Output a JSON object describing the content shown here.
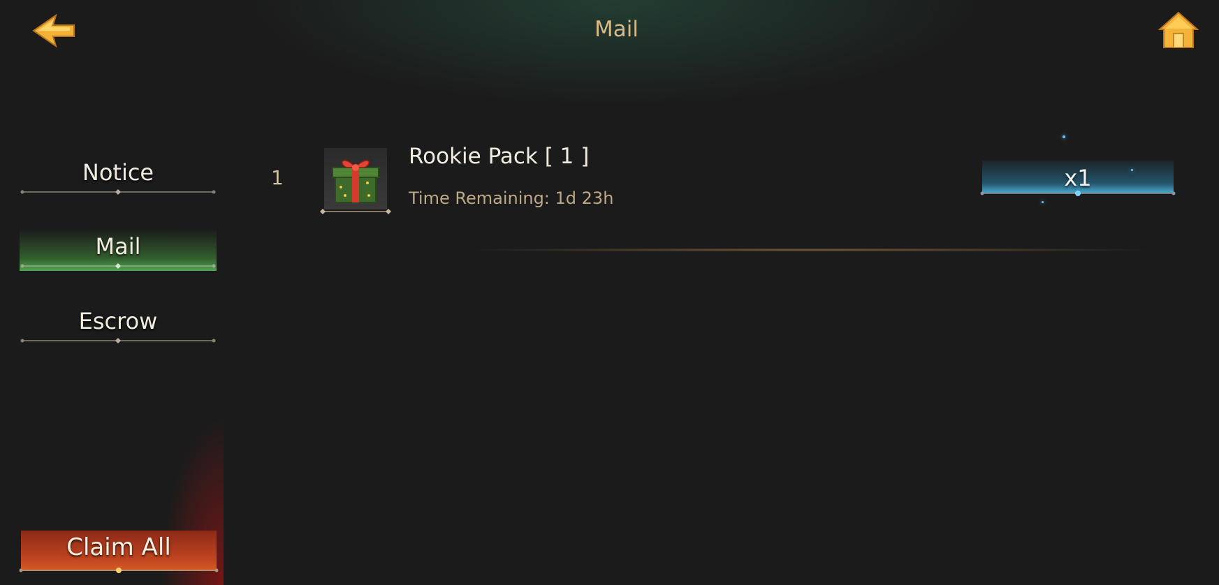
{
  "header": {
    "title": "Mail",
    "back_icon": "back-arrow-icon",
    "home_icon": "home-icon"
  },
  "sidebar": {
    "items": [
      {
        "label": "Notice",
        "active": false
      },
      {
        "label": "Mail",
        "active": true
      },
      {
        "label": "Escrow",
        "active": false
      }
    ],
    "claim_all_label": "Claim All"
  },
  "mail_list": {
    "rows": [
      {
        "index": "1",
        "icon": "gift-box-icon",
        "name": "Rookie Pack [ 1 ]",
        "time_remaining": "Time Remaining: 1d 23h",
        "quantity": "x1"
      }
    ]
  },
  "colors": {
    "background": "#1b1b1b",
    "title_gold": "#d6b987",
    "active_tab_green": "#5abe5a",
    "claim_red": "#b8401f",
    "reward_blue": "#50bee6"
  }
}
